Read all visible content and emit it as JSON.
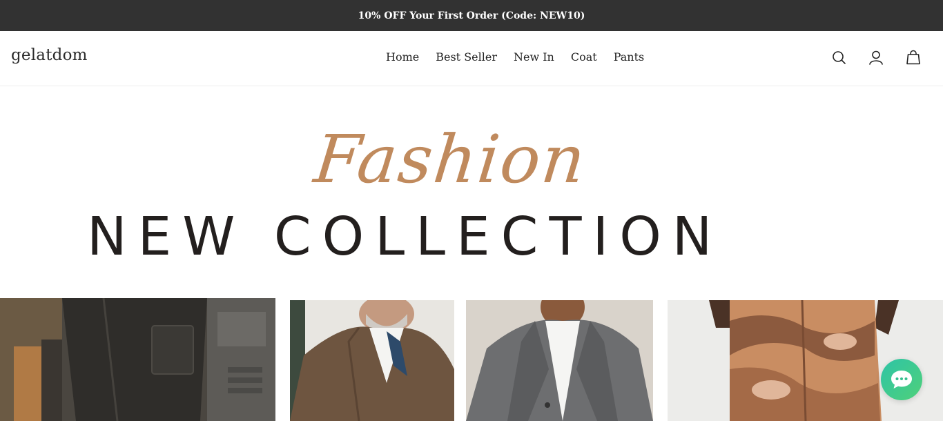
{
  "announcement": {
    "text": "10% OFF Your First Order (Code: NEW10)"
  },
  "header": {
    "logo": "gelatdom",
    "nav": [
      "Home",
      "Best Seller",
      "New In",
      "Coat",
      "Pants"
    ],
    "icons": [
      "search-icon",
      "account-icon",
      "cart-icon"
    ]
  },
  "hero": {
    "script_text": "Fashion",
    "title": "NEW COLLECTION",
    "accent_color": "#c08a5d",
    "title_color": "#231f1e"
  },
  "products": [
    {
      "name": "cargo-pants-photo"
    },
    {
      "name": "knit-jacket-photo"
    },
    {
      "name": "wool-coat-photo"
    },
    {
      "name": "printed-pants-photo"
    }
  ],
  "chat": {
    "icon": "chat-bubble-icon",
    "colors": [
      "#2ec4a6",
      "#4fd07a"
    ]
  }
}
